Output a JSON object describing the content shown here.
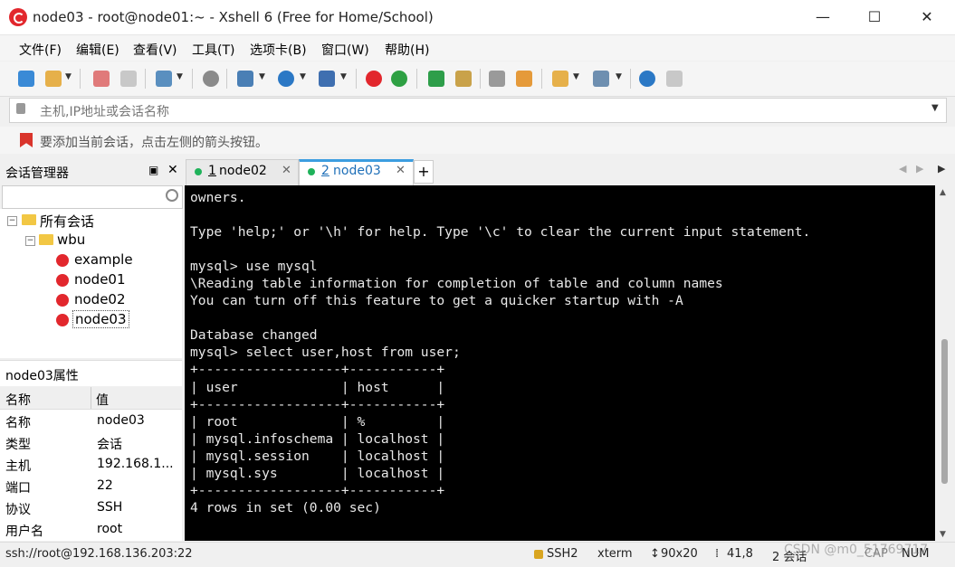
{
  "window": {
    "title": "node03 - root@node01:~ - Xshell 6 (Free for Home/School)",
    "minimize": "—",
    "maximize": "☐",
    "close": "✕"
  },
  "menu": [
    "文件(F)",
    "编辑(E)",
    "查看(V)",
    "工具(T)",
    "选项卡(B)",
    "窗口(W)",
    "帮助(H)"
  ],
  "address_bar": {
    "placeholder": "主机,IP地址或会话名称"
  },
  "hint": "要添加当前会话，点击左侧的箭头按钮。",
  "session_manager": {
    "title": "会话管理器",
    "tree": {
      "root": "所有会话",
      "folder": "wbu",
      "sessions": [
        "example",
        "node01",
        "node02",
        "node03"
      ],
      "selected": "node03"
    }
  },
  "properties": {
    "title": "node03属性",
    "header": {
      "name": "名称",
      "value": "值"
    },
    "rows": [
      {
        "k": "名称",
        "v": "node03"
      },
      {
        "k": "类型",
        "v": "会话"
      },
      {
        "k": "主机",
        "v": "192.168.1..."
      },
      {
        "k": "端口",
        "v": "22"
      },
      {
        "k": "协议",
        "v": "SSH"
      },
      {
        "k": "用户名",
        "v": "root"
      }
    ]
  },
  "tabs": [
    {
      "num": "1",
      "label": "node02",
      "active": false
    },
    {
      "num": "2",
      "label": "node03",
      "active": true
    }
  ],
  "terminal": {
    "lines": [
      "owners.",
      "",
      "Type 'help;' or '\\h' for help. Type '\\c' to clear the current input statement.",
      "",
      "mysql> use mysql",
      "\\Reading table information for completion of table and column names",
      "You can turn off this feature to get a quicker startup with -A",
      "",
      "Database changed",
      "mysql> select user,host from user;",
      "+------------------+-----------+",
      "| user             | host      |",
      "+------------------+-----------+",
      "| root             | %         |",
      "| mysql.infoschema | localhost |",
      "| mysql.session    | localhost |",
      "| mysql.sys        | localhost |",
      "+------------------+-----------+",
      "4 rows in set (0.00 sec)"
    ]
  },
  "status": {
    "connection": "ssh://root@192.168.136.203:22",
    "protocol": "SSH2",
    "term": "xterm",
    "size": "90x20",
    "cursor": "41,8",
    "sessions": "2 会话",
    "cap": "CAP",
    "num": "NUM",
    "watermark": "CSDN @m0_51769717"
  },
  "colors": {
    "accent_tab": "#3c9de0",
    "terminal_bg": "#000000",
    "terminal_fg": "#e8e8e8",
    "brand_red": "#e2272d"
  }
}
